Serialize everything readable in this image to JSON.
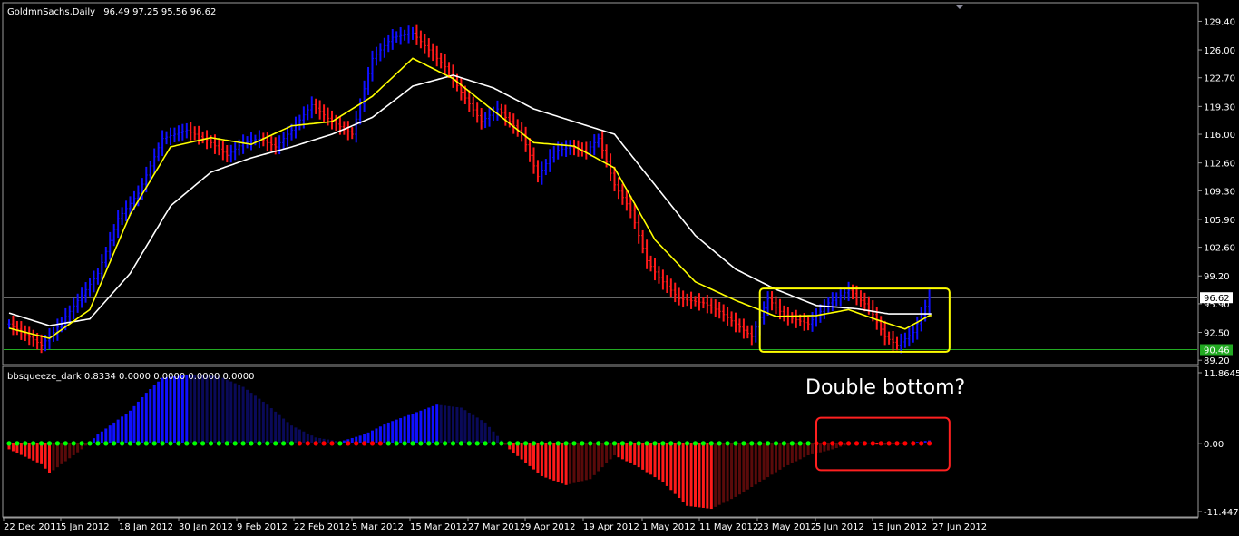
{
  "header": {
    "symbol": "GoldmnSachs,Daily",
    "ohlc": "96.49 97.25 95.56 96.62",
    "indicator": "bbsqueeze_dark 0.8334 0.0000 0.0000 0.0000 0.0000"
  },
  "annotation": {
    "note": "Double bottom?"
  },
  "colors": {
    "background": "#000000",
    "bull": "#1010ff",
    "bear": "#ff1a1a",
    "dark_bull": "#0a0a5a",
    "dark_bear": "#5a0a0a",
    "fast_ma": "#ffff00",
    "slow_ma": "#ffffff",
    "squeeze_off": "#00ff00",
    "squeeze_on": "#ff0000",
    "last_price_tag": "#ffffff",
    "low_tag": "#22aa22"
  },
  "chart_data": [
    {
      "type": "bar",
      "title": "",
      "subtype": "ohlc",
      "x_tick_labels": [
        "22 Dec 2011",
        "5 Jan 2012",
        "18 Jan 2012",
        "30 Jan 2012",
        "9 Feb 2012",
        "22 Feb 2012",
        "5 Mar 2012",
        "15 Mar 2012",
        "27 Mar 2012",
        "9 Apr 2012",
        "19 Apr 2012",
        "1 May 2012",
        "11 May 2012",
        "23 May 2012",
        "5 Jun 2012",
        "15 Jun 2012",
        "27 Jun 2012"
      ],
      "y_tick_labels": [
        "129.40",
        "126.00",
        "122.70",
        "119.30",
        "116.00",
        "112.60",
        "109.30",
        "105.90",
        "102.60",
        "99.20",
        "95.90",
        "92.50",
        "89.20"
      ],
      "ylim": [
        88.9,
        130.2
      ],
      "last_price": "96.62",
      "low_line": "90.46",
      "close_path": [
        [
          0,
          93.5
        ],
        [
          8,
          91.0
        ],
        [
          11,
          92.5
        ],
        [
          15,
          95.0
        ],
        [
          22,
          99.5
        ],
        [
          27,
          106.0
        ],
        [
          32,
          109.0
        ],
        [
          38,
          115.5
        ],
        [
          44,
          116.5
        ],
        [
          50,
          115.0
        ],
        [
          54,
          113.5
        ],
        [
          58,
          115.0
        ],
        [
          62,
          115.5
        ],
        [
          66,
          114.5
        ],
        [
          70,
          116.5
        ],
        [
          75,
          119.5
        ],
        [
          80,
          117.5
        ],
        [
          85,
          116.0
        ],
        [
          90,
          125.0
        ],
        [
          95,
          127.5
        ],
        [
          100,
          128.0
        ],
        [
          104,
          126.0
        ],
        [
          108,
          124.0
        ],
        [
          112,
          121.0
        ],
        [
          117,
          117.5
        ],
        [
          121,
          119.0
        ],
        [
          127,
          116.0
        ],
        [
          131,
          111.0
        ],
        [
          135,
          114.0
        ],
        [
          139,
          114.5
        ],
        [
          143,
          114.0
        ],
        [
          146,
          115.5
        ],
        [
          150,
          110.0
        ],
        [
          154,
          107.0
        ],
        [
          158,
          101.0
        ],
        [
          161,
          99.0
        ],
        [
          166,
          96.5
        ],
        [
          172,
          96.0
        ],
        [
          176,
          95.0
        ],
        [
          180,
          93.5
        ],
        [
          184,
          92.0
        ],
        [
          188,
          96.5
        ],
        [
          192,
          94.5
        ],
        [
          198,
          93.5
        ],
        [
          203,
          96.0
        ],
        [
          208,
          97.5
        ],
        [
          213,
          95.5
        ],
        [
          217,
          92.0
        ],
        [
          220,
          91.0
        ],
        [
          224,
          92.5
        ],
        [
          228,
          96.62
        ]
      ],
      "fast_ma_path": [
        [
          0,
          93.0
        ],
        [
          10,
          91.8
        ],
        [
          20,
          95.2
        ],
        [
          30,
          106.5
        ],
        [
          40,
          114.5
        ],
        [
          50,
          115.6
        ],
        [
          60,
          114.8
        ],
        [
          70,
          117.0
        ],
        [
          80,
          117.5
        ],
        [
          90,
          120.5
        ],
        [
          100,
          125.0
        ],
        [
          110,
          122.6
        ],
        [
          120,
          118.8
        ],
        [
          130,
          115.0
        ],
        [
          140,
          114.6
        ],
        [
          150,
          112.0
        ],
        [
          160,
          103.5
        ],
        [
          170,
          98.5
        ],
        [
          180,
          96.3
        ],
        [
          190,
          94.4
        ],
        [
          200,
          94.5
        ],
        [
          208,
          95.2
        ],
        [
          215,
          94.0
        ],
        [
          222,
          92.9
        ],
        [
          228,
          94.5
        ]
      ],
      "slow_ma_path": [
        [
          0,
          94.8
        ],
        [
          10,
          93.3
        ],
        [
          20,
          94.1
        ],
        [
          30,
          99.5
        ],
        [
          40,
          107.5
        ],
        [
          50,
          111.5
        ],
        [
          60,
          113.2
        ],
        [
          70,
          114.5
        ],
        [
          80,
          116.0
        ],
        [
          90,
          118.0
        ],
        [
          100,
          121.7
        ],
        [
          110,
          123.0
        ],
        [
          120,
          121.5
        ],
        [
          130,
          119.0
        ],
        [
          140,
          117.5
        ],
        [
          150,
          116.0
        ],
        [
          160,
          110.0
        ],
        [
          170,
          104.0
        ],
        [
          180,
          100.0
        ],
        [
          190,
          97.6
        ],
        [
          200,
          95.7
        ],
        [
          210,
          95.3
        ],
        [
          218,
          94.7
        ],
        [
          228,
          94.7
        ]
      ],
      "highlight_box": {
        "x_range": [
          186,
          233
        ],
        "y_range": [
          90.2,
          97.7
        ]
      }
    },
    {
      "type": "bar",
      "title": "",
      "subtype": "histogram",
      "y_tick_labels": [
        "11.8645",
        "0.00",
        "-11.447"
      ],
      "ylim": [
        -11.447,
        11.8645
      ],
      "histogram_path": [
        [
          0,
          -1.0
        ],
        [
          8,
          -3.5
        ],
        [
          10,
          -5.0
        ],
        [
          14,
          -3.0
        ],
        [
          18,
          -1.0
        ],
        [
          22,
          1.5
        ],
        [
          26,
          3.5
        ],
        [
          30,
          5.5
        ],
        [
          34,
          8.5
        ],
        [
          38,
          11.0
        ],
        [
          44,
          11.5
        ],
        [
          52,
          11.3
        ],
        [
          58,
          9.5
        ],
        [
          64,
          6.5
        ],
        [
          70,
          3.0
        ],
        [
          76,
          1.0
        ],
        [
          82,
          0.3
        ],
        [
          88,
          1.5
        ],
        [
          94,
          3.5
        ],
        [
          100,
          5.0
        ],
        [
          106,
          6.5
        ],
        [
          112,
          6.0
        ],
        [
          118,
          3.5
        ],
        [
          124,
          -1.0
        ],
        [
          132,
          -5.5
        ],
        [
          138,
          -7.0
        ],
        [
          144,
          -6.0
        ],
        [
          150,
          -2.0
        ],
        [
          156,
          -4.0
        ],
        [
          162,
          -6.5
        ],
        [
          168,
          -10.5
        ],
        [
          174,
          -11.0
        ],
        [
          180,
          -9.0
        ],
        [
          186,
          -6.5
        ],
        [
          192,
          -4.0
        ],
        [
          198,
          -2.0
        ],
        [
          204,
          -1.0
        ],
        [
          210,
          0.3
        ],
        [
          216,
          -0.3
        ],
        [
          222,
          0.0
        ],
        [
          228,
          0.5
        ]
      ],
      "squeeze_on_ranges": [
        [
          72,
          80
        ],
        [
          84,
          92
        ],
        [
          200,
          228
        ]
      ],
      "highlight_box": {
        "x_range": [
          200,
          233
        ],
        "y_range": [
          -4.5,
          4.3
        ]
      }
    }
  ]
}
